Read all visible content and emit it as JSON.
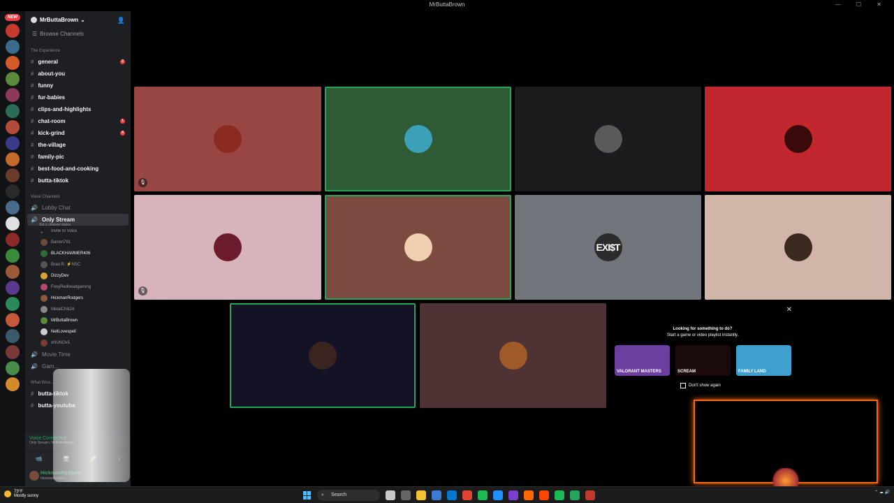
{
  "window": {
    "title": "MrButtaBrown"
  },
  "server_list": {
    "new_badge": "NEW"
  },
  "sidebar": {
    "guild_name": "MrButtaBrown",
    "browse_channels": "Browse Channels",
    "text_category": "The Experience",
    "text_channels": [
      {
        "label": "general",
        "badge": "2"
      },
      {
        "label": "about-you"
      },
      {
        "label": "funny"
      },
      {
        "label": "fur-babies"
      },
      {
        "label": "clips-and-highlights"
      },
      {
        "label": "chat-room",
        "badge": "1"
      },
      {
        "label": "kick-grind",
        "badge": "4"
      },
      {
        "label": "the-village"
      },
      {
        "label": "family-pic"
      },
      {
        "label": "best-food-and-cooking"
      },
      {
        "label": "butta-tiktok"
      }
    ],
    "voice_category": "Voice Channels",
    "voice_channels": [
      {
        "label": "Lobby Chat"
      },
      {
        "label": "Only Stream",
        "status": "Set a channel status"
      }
    ],
    "invite_label": "Invite to Voice",
    "members": [
      {
        "name": "Barren791",
        "color": "#6b4a3a",
        "online": false
      },
      {
        "name": "BLACKHAMMER406",
        "color": "#2e6b3a",
        "online": true
      },
      {
        "name": "Brad R. ⚡NSC",
        "color": "#555",
        "online": false
      },
      {
        "name": "DizzyDev",
        "color": "#d6a23a",
        "online": true
      },
      {
        "name": "FoxyRedheadgaming",
        "color": "#b34a6a",
        "online": false
      },
      {
        "name": "HickmanRodgers",
        "color": "#8a5a3a",
        "online": true
      },
      {
        "name": "MetalChik24",
        "color": "#888",
        "online": false
      },
      {
        "name": "MrButtaBrown",
        "color": "#5a8a3a",
        "online": true
      },
      {
        "name": "NellLovespell",
        "color": "#ccc",
        "online": true
      },
      {
        "name": "xNUNOx5",
        "color": "#7a3a3a",
        "online": false
      }
    ],
    "more_channels": [
      {
        "label": "Movie Time"
      },
      {
        "label": "Gam..."
      }
    ],
    "more_category": "What Wou...",
    "more_text_channels": [
      {
        "label": "butta-tiktok"
      },
      {
        "label": "butta-youtube"
      }
    ],
    "voice_connected": "Voice Connected",
    "voice_location": "Only Stream / MrButtaBrown",
    "user_name": "HickmanRodgers",
    "user_handle": "hickmanrodgers"
  },
  "stage": {
    "tiles": [
      {
        "bg": "#984643",
        "avatar": "#8b2a1f",
        "muted": true,
        "speaking": false
      },
      {
        "bg": "#2e5a36",
        "avatar": "#3b9fb8",
        "muted": false,
        "speaking": true
      },
      {
        "bg": "#1b1b1e",
        "avatar": "#5a5a5a",
        "muted": false,
        "speaking": false
      },
      {
        "bg": "#c1272d",
        "avatar": "#3a0a0a",
        "muted": false,
        "speaking": false
      },
      {
        "bg": "#d7b3bb",
        "avatar": "#6b1b2b",
        "muted": true,
        "speaking": false
      },
      {
        "bg": "#7d4a40",
        "avatar": "#f0d0b0",
        "muted": false,
        "speaking": true
      },
      {
        "bg": "#71767c",
        "avatar": "#2b2b2b",
        "text": "EXI$T",
        "muted": false,
        "speaking": false
      },
      {
        "bg": "#d1b5a8",
        "avatar": "#3a2a20",
        "muted": false,
        "speaking": false
      },
      {
        "bg": "#131325",
        "avatar": "#3a2420",
        "muted": false,
        "speaking": true
      },
      {
        "bg": "#4f3332",
        "avatar": "#a05a2a",
        "muted": false,
        "speaking": false
      }
    ]
  },
  "promo": {
    "title": "Looking for something to do?",
    "subtitle": "Start a game or video playlist instantly.",
    "cards": [
      {
        "label": "VALORANT MASTERS",
        "color": "#6b3fa0"
      },
      {
        "label": "SCREAM",
        "color": "#1a0a0a"
      },
      {
        "label": "FAMILY LAND",
        "color": "#3fa0d0"
      }
    ],
    "dont_show": "Don't show again"
  },
  "taskbar": {
    "temperature": "73°F",
    "weather": "Mostly sunny",
    "search": "Search",
    "apps": [
      "#c9c9c9",
      "#666",
      "#f1c232",
      "#3a7bd5",
      "#0078d4",
      "#e0432f",
      "#1db954",
      "#1e90ff",
      "#7a3fd0",
      "#ff6a00",
      "#ff4500",
      "#1db954",
      "#23a55a",
      "#c0392b"
    ]
  }
}
